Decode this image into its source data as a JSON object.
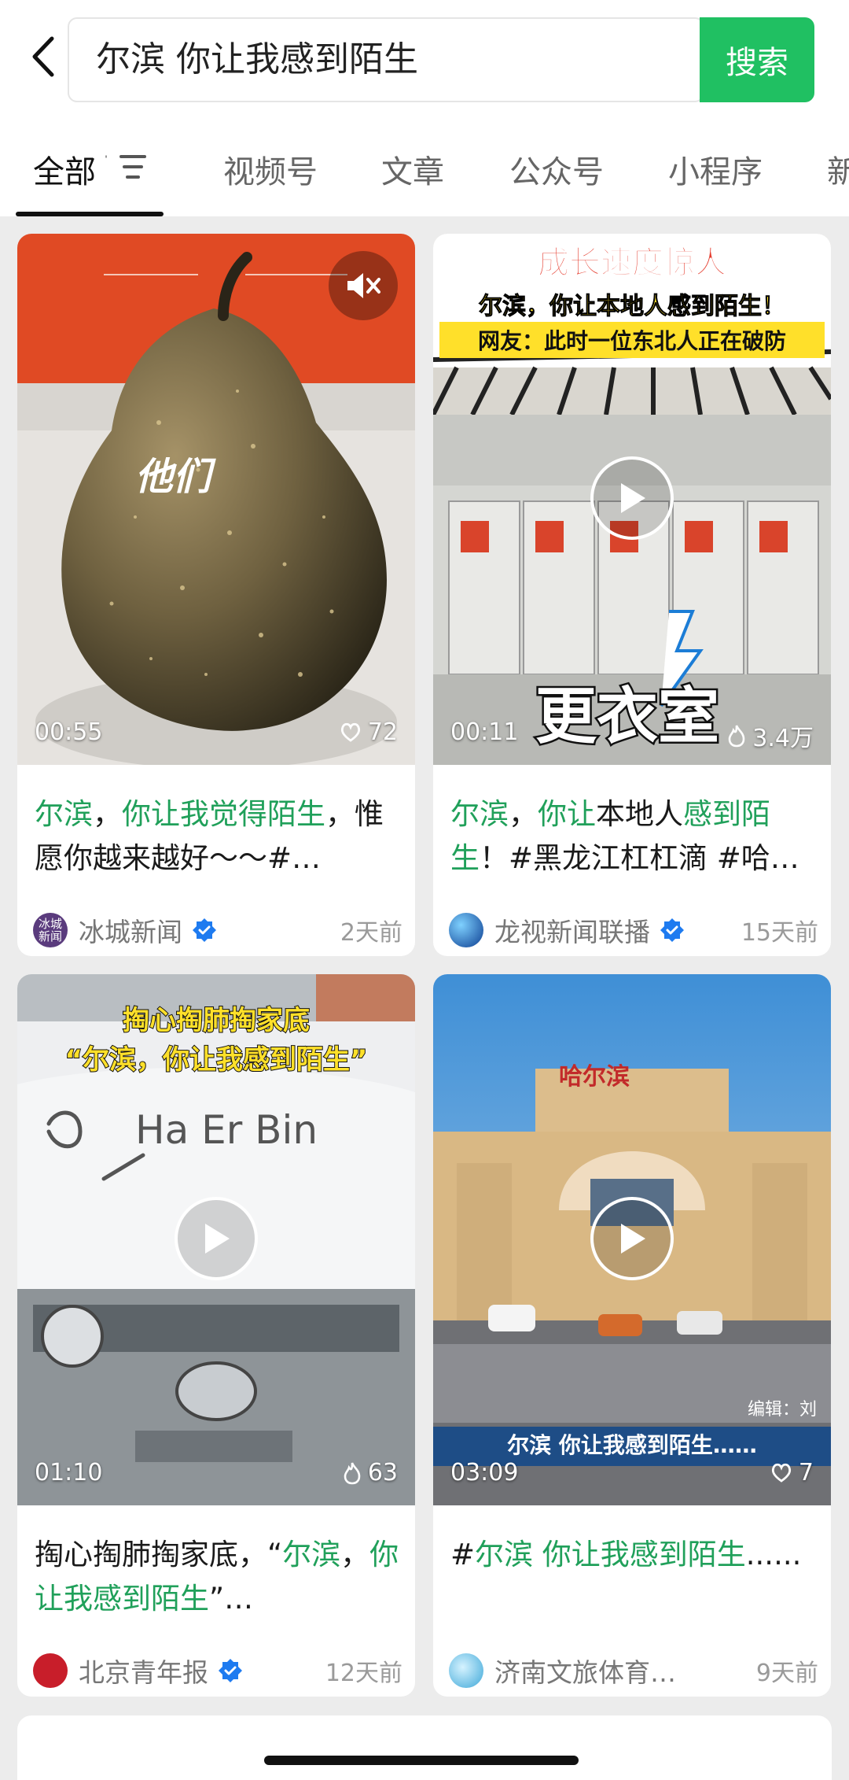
{
  "search": {
    "query": "尔滨 你让我感到陌生",
    "button_label": "搜索"
  },
  "tabs": [
    "全部",
    "视频号",
    "文章",
    "公众号",
    "小程序",
    "新"
  ],
  "cards": [
    {
      "duration": "00:55",
      "likes": "72",
      "overlay_text": "他们",
      "title_segments": [
        {
          "text": "尔滨",
          "hl": true
        },
        {
          "text": "，",
          "hl": false
        },
        {
          "text": "你让我觉得陌生",
          "hl": true
        },
        {
          "text": "，惟愿你越来越好～～#…",
          "hl": false
        }
      ],
      "author": "冰城新闻",
      "avatar_text": "冰城\n新闻",
      "verified": true,
      "age": "2天前"
    },
    {
      "duration": "00:11",
      "likes": "3.4万",
      "overlay_title": "成长速度惊人",
      "overlay_line2": "尔滨，你让本地人感到陌生！",
      "overlay_line3": "网友：此时一位东北人正在破防",
      "overlay_big": "更衣室",
      "title_segments": [
        {
          "text": "尔滨",
          "hl": true
        },
        {
          "text": "，",
          "hl": false
        },
        {
          "text": "你让",
          "hl": true
        },
        {
          "text": "本地人",
          "hl": false
        },
        {
          "text": "感到陌生",
          "hl": true
        },
        {
          "text": "！#黑龙江杠杠滴 #哈…",
          "hl": false
        }
      ],
      "author": "龙视新闻联播",
      "verified": true,
      "age": "15天前"
    },
    {
      "duration": "01:10",
      "likes": "63",
      "overlay_line1": "掏心掏肺掏家底",
      "overlay_line2": "“尔滨，你让我感到陌生”",
      "overlay_snow": "Ha Er Bin",
      "title_segments": [
        {
          "text": "掏心掏肺掏家底，“",
          "hl": false
        },
        {
          "text": "尔滨",
          "hl": true
        },
        {
          "text": "，",
          "hl": false
        },
        {
          "text": "你让我感到陌生",
          "hl": true
        },
        {
          "text": "”…",
          "hl": false
        }
      ],
      "author": "北京青年报",
      "verified": true,
      "age": "12天前"
    },
    {
      "duration": "03:09",
      "likes": "7",
      "overlay_station": "哈尔滨",
      "overlay_caption": "尔滨 你让我感到陌生……",
      "overlay_editor": "编辑：刘",
      "title_segments": [
        {
          "text": "#",
          "hl": false
        },
        {
          "text": "尔滨 你让我感到陌生",
          "hl": true
        },
        {
          "text": "......",
          "hl": false
        }
      ],
      "author": "济南文旅体育…",
      "verified": false,
      "age": "9天前"
    }
  ],
  "colors": {
    "accent_green": "#20c062",
    "highlight_green": "#20a05a",
    "verified_blue": "#1e7bf0"
  }
}
